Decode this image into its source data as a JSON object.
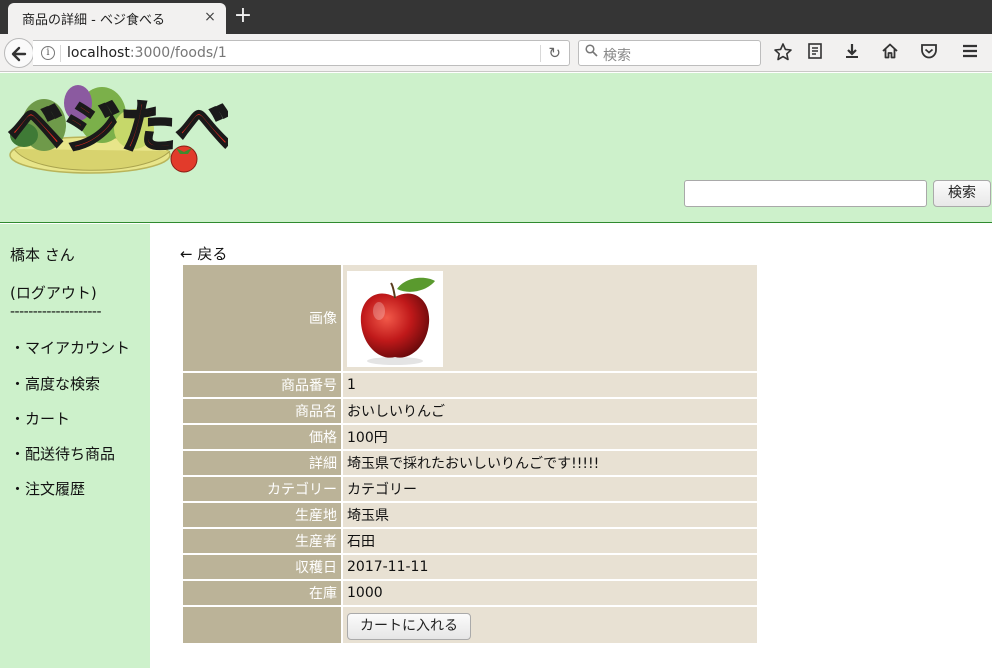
{
  "browser": {
    "tab_title": "商品の詳細 - ベジ食べる",
    "tab_close": "×",
    "new_tab": "+",
    "url_host": "localhost",
    "url_path": ":3000/foods/1",
    "search_placeholder": "検索",
    "icons": [
      "back-icon",
      "info-icon",
      "reload-icon",
      "search-icon",
      "star-icon",
      "reader-icon",
      "download-icon",
      "home-icon",
      "pocket-icon",
      "menu-icon"
    ]
  },
  "header": {
    "logo_text": "ベジたべる",
    "search_value": "",
    "search_button": "検索",
    "colors": {
      "background": "#cdf1cb",
      "logo_red": "#d8281e"
    }
  },
  "sidebar": {
    "user": "橋本 さん",
    "logout": "(ログアウト)",
    "divider": "--------------------",
    "links": [
      "・マイアカウント",
      "・高度な検索",
      "・カート",
      "・配送待ち商品",
      "・注文履歴"
    ]
  },
  "main": {
    "back_link": "← 戻る",
    "rows": [
      {
        "label": "画像",
        "value": ""
      },
      {
        "label": "商品番号",
        "value": "1"
      },
      {
        "label": "商品名",
        "value": "おいしいりんご"
      },
      {
        "label": "価格",
        "value": "100円"
      },
      {
        "label": "詳細",
        "value": "埼玉県で採れたおいしいりんごです!!!!!"
      },
      {
        "label": "カテゴリー",
        "value": "カテゴリー"
      },
      {
        "label": "生産地",
        "value": "埼玉県"
      },
      {
        "label": "生産者",
        "value": "石田"
      },
      {
        "label": "収穫日",
        "value": "2017-11-11"
      },
      {
        "label": "在庫",
        "value": "1000"
      }
    ],
    "cart_button": "カートに入れる",
    "colors": {
      "label_bg": "#bbb398",
      "value_bg": "#e8e1d3"
    }
  }
}
